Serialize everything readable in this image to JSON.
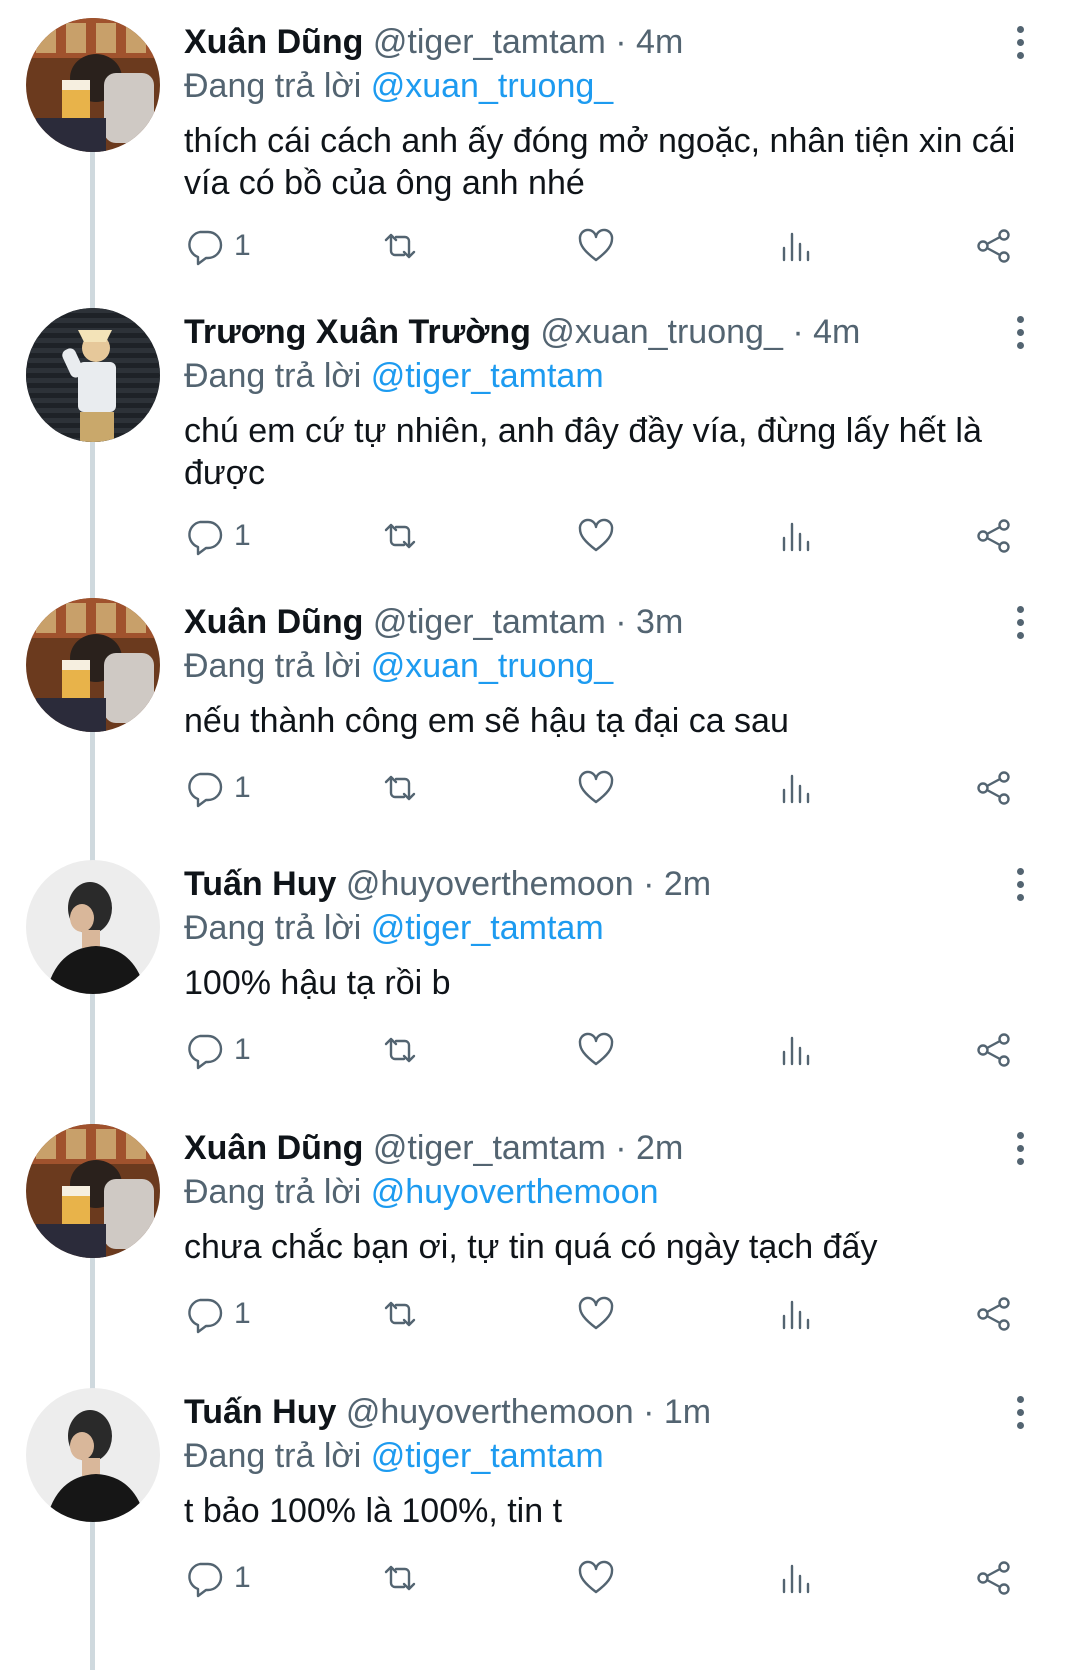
{
  "reply_prefix": "Đang trả lời",
  "tweets": [
    {
      "name": "Xuân Dũng",
      "handle": "@tiger_tamtam",
      "dot": "·",
      "time": "4m",
      "reply_to": "@xuan_truong_",
      "text": "thích cái cách anh ấy đóng mở ngoặc, nhân tiện xin cái vía có bồ của ông anh nhé",
      "reply_count": "1",
      "avatar": "avatar-xuan-dung"
    },
    {
      "name": "Trương Xuân Trường",
      "handle": "@xuan_truong_",
      "dot": "·",
      "time": "4m",
      "reply_to": "@tiger_tamtam",
      "text": "chú em cứ tự nhiên, anh đây đầy vía, đừng lấy hết là được",
      "reply_count": "1",
      "avatar": "avatar-truong-xuan-truong"
    },
    {
      "name": "Xuân Dũng",
      "handle": "@tiger_tamtam",
      "dot": "·",
      "time": "3m",
      "reply_to": "@xuan_truong_",
      "text": "nếu thành công em sẽ hậu tạ đại ca sau",
      "reply_count": "1",
      "avatar": "avatar-xuan-dung"
    },
    {
      "name": "Tuấn Huy",
      "handle": "@huyoverthemoon",
      "dot": "·",
      "time": "2m",
      "reply_to": "@tiger_tamtam",
      "text": "100% hậu tạ rồi b",
      "reply_count": "1",
      "avatar": "avatar-tuan-huy"
    },
    {
      "name": "Xuân Dũng",
      "handle": "@tiger_tamtam",
      "dot": "·",
      "time": "2m",
      "reply_to": "@huyoverthemoon",
      "text": "chưa chắc bạn ơi, tự tin quá có ngày tạch đấy",
      "reply_count": "1",
      "avatar": "avatar-xuan-dung"
    },
    {
      "name": "Tuấn Huy",
      "handle": "@huyoverthemoon",
      "dot": "·",
      "time": "1m",
      "reply_to": "@tiger_tamtam",
      "text": "t bảo 100% là 100%, tin t",
      "reply_count": "1",
      "avatar": "avatar-tuan-huy"
    }
  ],
  "icons": {
    "reply": "reply-icon",
    "retweet": "retweet-icon",
    "like": "like-icon",
    "stats": "stats-icon",
    "share": "share-icon",
    "more": "more-icon"
  },
  "colors": {
    "mention": "#1d9bf0",
    "secondary": "#536471",
    "thread_line": "#cfd9de"
  }
}
